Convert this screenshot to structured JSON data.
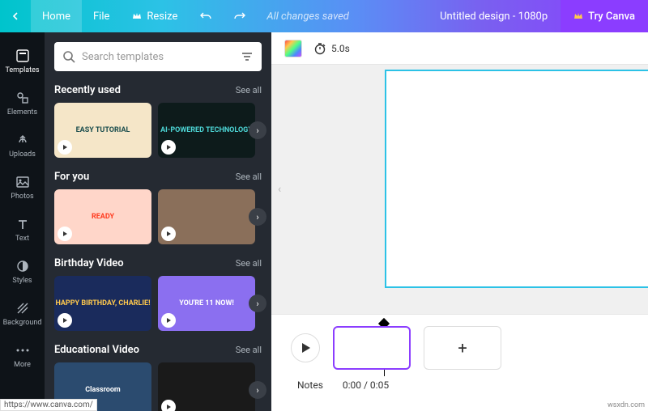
{
  "topbar": {
    "home": "Home",
    "file": "File",
    "resize": "Resize",
    "status": "All changes saved",
    "title": "Untitled design - 1080p",
    "try": "Try Canva"
  },
  "rail": {
    "items": [
      {
        "label": "Templates"
      },
      {
        "label": "Elements"
      },
      {
        "label": "Uploads"
      },
      {
        "label": "Photos"
      },
      {
        "label": "Text"
      },
      {
        "label": "Styles"
      },
      {
        "label": "Background"
      },
      {
        "label": "More"
      }
    ]
  },
  "panel": {
    "search_placeholder": "Search templates",
    "sections": [
      {
        "title": "Recently used",
        "see_all": "See all",
        "thumbs": [
          "EASY TUTORIAL",
          "AI-POWERED TECHNOLOGY"
        ]
      },
      {
        "title": "For you",
        "see_all": "See all",
        "thumbs": [
          "READY",
          ""
        ]
      },
      {
        "title": "Birthday Video",
        "see_all": "See all",
        "thumbs": [
          "HAPPY BIRTHDAY, CHARLIE!",
          "YOU'RE 11 NOW!"
        ]
      },
      {
        "title": "Educational Video",
        "see_all": "See all",
        "thumbs": [
          "Classroom",
          ""
        ]
      }
    ]
  },
  "canvas": {
    "duration": "5.0s"
  },
  "timeline": {
    "notes": "Notes",
    "time": "0:00 / 0:05"
  },
  "statusbar": "https://www.canva.com/",
  "watermark": "wsxdn.com",
  "thumb_styles": [
    [
      {
        "bg": "#f5e6c8",
        "color": "#1a4d4d"
      },
      {
        "bg": "#0d1b1b",
        "color": "#4dd6d6"
      }
    ],
    [
      {
        "bg": "#ffd6c9",
        "color": "#ff3b1f"
      },
      {
        "bg": "#8a6f5a",
        "color": "#fff"
      }
    ],
    [
      {
        "bg": "#1a2b5c",
        "color": "#ffc94d"
      },
      {
        "bg": "#8b6ff0",
        "color": "#fff"
      }
    ],
    [
      {
        "bg": "#2b4b6f",
        "color": "#fff"
      },
      {
        "bg": "#1a1a1a",
        "color": "#ff8833"
      }
    ]
  ]
}
